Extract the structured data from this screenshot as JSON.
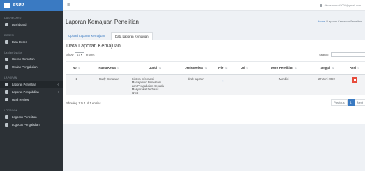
{
  "brand": {
    "name": "ASPP"
  },
  "sidebar": {
    "sections": [
      {
        "label": "DASHBOARD",
        "items": [
          {
            "label": "Dashboard"
          }
        ]
      },
      {
        "label": "DOSEN",
        "items": [
          {
            "label": "Data Dosen"
          }
        ]
      },
      {
        "label": "Usulan Usulan",
        "items": [
          {
            "label": "Usulan Penelitian"
          },
          {
            "label": "Usulan Pengabdian"
          }
        ]
      },
      {
        "label": "LAPORAN",
        "items": [
          {
            "label": "Laporan Penelitian"
          },
          {
            "label": "Laporan Pengabdian"
          },
          {
            "label": "Hasil Review"
          }
        ]
      },
      {
        "label": "LOGBOOK",
        "items": [
          {
            "label": "Logbook Penelitian"
          },
          {
            "label": "Logbook Pengabdian"
          }
        ]
      }
    ]
  },
  "topbar": {
    "user": "dimas.ahmad2000@gmail.com"
  },
  "page": {
    "title": "Laporan Kemajuan Penelitian",
    "breadcrumb_home": "Home",
    "breadcrumb_current": "Laporan Kemajuan Penelitian"
  },
  "tabs": [
    "Upload Laporan Kemajuan",
    "Data Laporan Kemajuan"
  ],
  "card": {
    "title": "Data Laporan Kemajuan",
    "show_label": "Show",
    "show_value": "10",
    "entries_label": "entries",
    "search_label": "Search:"
  },
  "table": {
    "headers": [
      "No",
      "Nama Ketua",
      "Judul",
      "Jenis Berkas",
      "File",
      "Url",
      "Jenis Penelitian",
      "Tanggal",
      "Aksi"
    ],
    "rows": [
      {
        "no": "1",
        "nama_ketua": "Rudy Gunawan",
        "judul": [
          "Sistem Informasi",
          "Manajemen Penelitian",
          "dan Pengabdian Kepada",
          "Masyarakat berbasis",
          "WEB"
        ],
        "jenis_berkas": "draft laporan",
        "url": "",
        "jenis_penelitian": "Mandiri",
        "tanggal": "27 Juni 2022"
      }
    ]
  },
  "footer": {
    "info": "Showing 1 to 1 of 1 entries",
    "prev": "Previous",
    "page": "1",
    "next": "Next"
  },
  "colors": {
    "primary": "#3a7ac2",
    "sidebar": "#2c3136",
    "danger": "#e74c3c"
  }
}
